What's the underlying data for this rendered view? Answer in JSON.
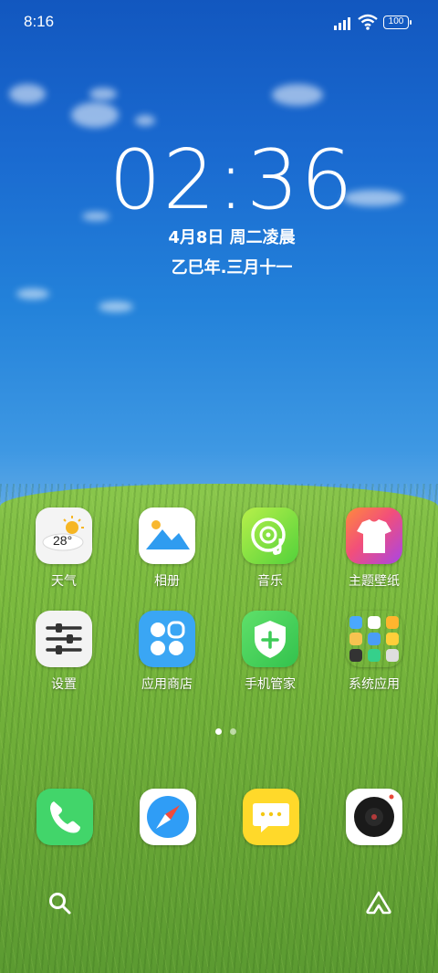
{
  "status_bar": {
    "time": "8:16",
    "battery": "100"
  },
  "lock_clock": {
    "time": "02:36",
    "date": "4月8日 周二凌晨",
    "lunar": "乙巳年.三月十一"
  },
  "weather_widget": {
    "temperature": "28°"
  },
  "apps": [
    {
      "label": "天气",
      "icon": "weather-icon"
    },
    {
      "label": "相册",
      "icon": "gallery-icon"
    },
    {
      "label": "音乐",
      "icon": "music-icon"
    },
    {
      "label": "主题壁纸",
      "icon": "theme-icon"
    },
    {
      "label": "设置",
      "icon": "settings-icon"
    },
    {
      "label": "应用商店",
      "icon": "app-store-icon"
    },
    {
      "label": "手机管家",
      "icon": "security-icon"
    },
    {
      "label": "系统应用",
      "icon": "folder-icon"
    }
  ],
  "page_indicator": {
    "current": 1,
    "total": 2
  },
  "dock": [
    {
      "name": "phone",
      "icon": "phone-icon"
    },
    {
      "name": "browser",
      "icon": "compass-icon"
    },
    {
      "name": "messages",
      "icon": "message-icon"
    },
    {
      "name": "camera",
      "icon": "camera-icon"
    }
  ],
  "colors": {
    "sky": "#1a6ad0",
    "grass": "#72b13a",
    "text": "#ffffff"
  }
}
